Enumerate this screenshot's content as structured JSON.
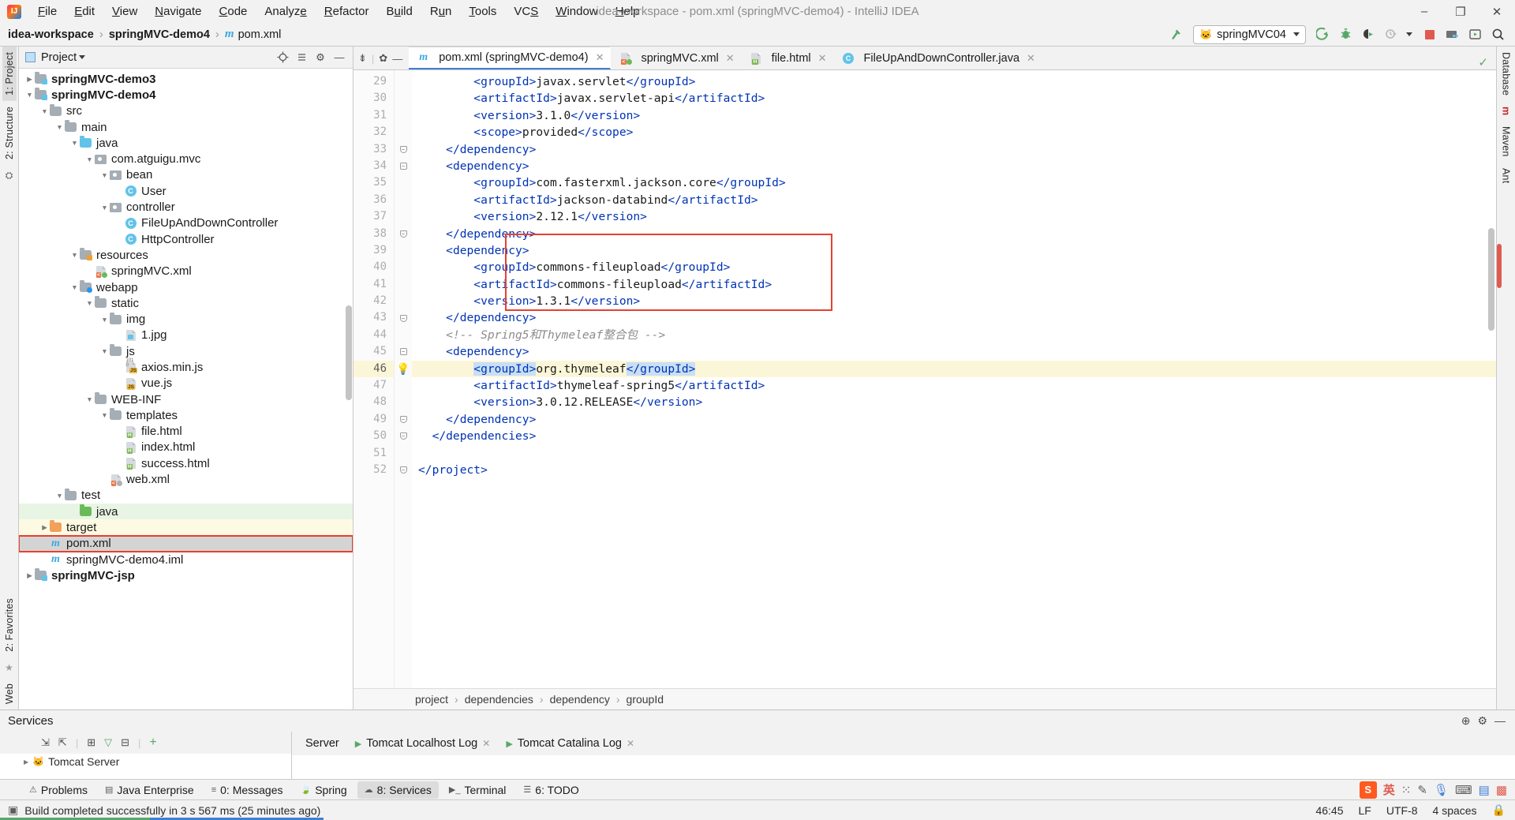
{
  "titlebar": {
    "logo": "IJ",
    "menus": [
      "File",
      "Edit",
      "View",
      "Navigate",
      "Code",
      "Analyze",
      "Refactor",
      "Build",
      "Run",
      "Tools",
      "VCS",
      "Window",
      "Help"
    ],
    "window_title": "idea-workspace - pom.xml (springMVC-demo4) - IntelliJ IDEA",
    "minimize": "–",
    "maximize": "❐",
    "close": "✕"
  },
  "navbar": {
    "breadcrumb": [
      "idea-workspace",
      "springMVC-demo4",
      "pom.xml"
    ],
    "separator": "›",
    "maven_icon": "m",
    "run_config": "springMVC04",
    "icons": {
      "hammer": "build-icon",
      "run": "run-icon",
      "debug": "debug-icon",
      "coverage": "run-with-coverage-icon",
      "profile": "profile-icon",
      "stop": "stop-icon",
      "project_structure": "project-structure-icon",
      "updates": "updates-icon",
      "search": "search-everywhere-icon"
    }
  },
  "left_strip": {
    "tabs": [
      "1: Project",
      "2: Structure"
    ],
    "bottom_tabs": [
      "2: Favorites",
      "Web"
    ]
  },
  "right_strip": {
    "tabs": [
      "Database",
      "m",
      "Maven",
      "Ant"
    ]
  },
  "project": {
    "title": "Project",
    "tree": [
      {
        "label": "springMVC-demo3",
        "indent": 1,
        "arrow": "collapsed",
        "icon": "module-folder",
        "bold": true
      },
      {
        "label": "springMVC-demo4",
        "indent": 1,
        "arrow": "expanded",
        "icon": "module-folder",
        "bold": true
      },
      {
        "label": "src",
        "indent": 2,
        "arrow": "expanded",
        "icon": "folder-gray"
      },
      {
        "label": "main",
        "indent": 3,
        "arrow": "expanded",
        "icon": "folder-gray"
      },
      {
        "label": "java",
        "indent": 4,
        "arrow": "expanded",
        "icon": "folder-blue"
      },
      {
        "label": "com.atguigu.mvc",
        "indent": 5,
        "arrow": "expanded",
        "icon": "package"
      },
      {
        "label": "bean",
        "indent": 6,
        "arrow": "expanded",
        "icon": "package"
      },
      {
        "label": "User",
        "indent": 7,
        "arrow": "none",
        "icon": "class"
      },
      {
        "label": "controller",
        "indent": 6,
        "arrow": "expanded",
        "icon": "package"
      },
      {
        "label": "FileUpAndDownController",
        "indent": 7,
        "arrow": "none",
        "icon": "class"
      },
      {
        "label": "HttpController",
        "indent": 7,
        "arrow": "none",
        "icon": "class"
      },
      {
        "label": "resources",
        "indent": 4,
        "arrow": "expanded",
        "icon": "folder-resources"
      },
      {
        "label": "springMVC.xml",
        "indent": 5,
        "arrow": "none",
        "icon": "spring-xml"
      },
      {
        "label": "webapp",
        "indent": 4,
        "arrow": "expanded",
        "icon": "webapp"
      },
      {
        "label": "static",
        "indent": 5,
        "arrow": "expanded",
        "icon": "folder-gray"
      },
      {
        "label": "img",
        "indent": 6,
        "arrow": "expanded",
        "icon": "folder-gray"
      },
      {
        "label": "1.jpg",
        "indent": 7,
        "arrow": "none",
        "icon": "image-file"
      },
      {
        "label": "js",
        "indent": 6,
        "arrow": "expanded",
        "icon": "folder-gray"
      },
      {
        "label": "axios.min.js",
        "indent": 7,
        "arrow": "none",
        "icon": "js-min-file"
      },
      {
        "label": "vue.js",
        "indent": 7,
        "arrow": "none",
        "icon": "js-file"
      },
      {
        "label": "WEB-INF",
        "indent": 5,
        "arrow": "expanded",
        "icon": "folder-gray"
      },
      {
        "label": "templates",
        "indent": 6,
        "arrow": "expanded",
        "icon": "folder-gray"
      },
      {
        "label": "file.html",
        "indent": 7,
        "arrow": "none",
        "icon": "html-file"
      },
      {
        "label": "index.html",
        "indent": 7,
        "arrow": "none",
        "icon": "html-file"
      },
      {
        "label": "success.html",
        "indent": 7,
        "arrow": "none",
        "icon": "html-file"
      },
      {
        "label": "web.xml",
        "indent": 6,
        "arrow": "none",
        "icon": "web-xml"
      },
      {
        "label": "test",
        "indent": 3,
        "arrow": "expanded",
        "icon": "folder-gray"
      },
      {
        "label": "java",
        "indent": 4,
        "arrow": "none",
        "icon": "folder-green",
        "highlight": "green"
      },
      {
        "label": "target",
        "indent": 2,
        "arrow": "collapsed",
        "icon": "folder-orange",
        "highlight": "yellow"
      },
      {
        "label": "pom.xml",
        "indent": 2,
        "arrow": "none",
        "icon": "maven-file",
        "highlight": "selected",
        "boxed": true
      },
      {
        "label": "springMVC-demo4.iml",
        "indent": 2,
        "arrow": "none",
        "icon": "iml-file"
      },
      {
        "label": "springMVC-jsp",
        "indent": 1,
        "arrow": "collapsed",
        "icon": "module-folder",
        "bold": true
      }
    ]
  },
  "editor": {
    "tabs": [
      {
        "label": "pom.xml (springMVC-demo4)",
        "icon": "maven-file",
        "active": true,
        "close": "✕"
      },
      {
        "label": "springMVC.xml",
        "icon": "spring-xml",
        "active": false,
        "close": "✕"
      },
      {
        "label": "file.html",
        "icon": "html-file",
        "active": false,
        "close": "✕"
      },
      {
        "label": "FileUpAndDownController.java",
        "icon": "class",
        "active": false,
        "close": "✕"
      }
    ],
    "inspection_ok": "✓",
    "lines": [
      {
        "n": 29,
        "indent": 8,
        "parts": [
          {
            "t": "tg",
            "v": "<groupId>"
          },
          {
            "t": "x",
            "v": "javax.servlet"
          },
          {
            "t": "tg",
            "v": "</groupId>"
          }
        ]
      },
      {
        "n": 30,
        "indent": 8,
        "parts": [
          {
            "t": "tg",
            "v": "<artifactId>"
          },
          {
            "t": "x",
            "v": "javax.servlet-api"
          },
          {
            "t": "tg",
            "v": "</artifactId>"
          }
        ]
      },
      {
        "n": 31,
        "indent": 8,
        "parts": [
          {
            "t": "tg",
            "v": "<version>"
          },
          {
            "t": "x",
            "v": "3.1.0"
          },
          {
            "t": "tg",
            "v": "</version>"
          }
        ]
      },
      {
        "n": 32,
        "indent": 8,
        "parts": [
          {
            "t": "tg",
            "v": "<scope>"
          },
          {
            "t": "x",
            "v": "provided"
          },
          {
            "t": "tg",
            "v": "</scope>"
          }
        ]
      },
      {
        "n": 33,
        "indent": 4,
        "fold": "end",
        "parts": [
          {
            "t": "tg",
            "v": "</dependency>"
          }
        ]
      },
      {
        "n": 34,
        "indent": 4,
        "fold": "start",
        "parts": [
          {
            "t": "tg",
            "v": "<dependency>"
          }
        ]
      },
      {
        "n": 35,
        "indent": 8,
        "parts": [
          {
            "t": "tg",
            "v": "<groupId>"
          },
          {
            "t": "x",
            "v": "com.fasterxml.jackson.core"
          },
          {
            "t": "tg",
            "v": "</groupId>"
          }
        ]
      },
      {
        "n": 36,
        "indent": 8,
        "parts": [
          {
            "t": "tg",
            "v": "<artifactId>"
          },
          {
            "t": "x",
            "v": "jackson-databind"
          },
          {
            "t": "tg",
            "v": "</artifactId>"
          }
        ]
      },
      {
        "n": 37,
        "indent": 8,
        "parts": [
          {
            "t": "tg",
            "v": "<version>"
          },
          {
            "t": "x",
            "v": "2.12.1"
          },
          {
            "t": "tg",
            "v": "</version>"
          }
        ]
      },
      {
        "n": 38,
        "indent": 4,
        "fold": "end",
        "parts": [
          {
            "t": "tg",
            "v": "</dependency>"
          }
        ]
      },
      {
        "n": 39,
        "indent": 4,
        "parts": [
          {
            "t": "tg",
            "v": "<dependency>"
          }
        ]
      },
      {
        "n": 40,
        "indent": 8,
        "parts": [
          {
            "t": "tg",
            "v": "<groupId>"
          },
          {
            "t": "x",
            "v": "commons-fileupload"
          },
          {
            "t": "tg",
            "v": "</groupId>"
          }
        ]
      },
      {
        "n": 41,
        "indent": 8,
        "parts": [
          {
            "t": "tg",
            "v": "<artifactId>"
          },
          {
            "t": "x",
            "v": "commons-fileupload"
          },
          {
            "t": "tg",
            "v": "</artifactId>"
          }
        ]
      },
      {
        "n": 42,
        "indent": 8,
        "parts": [
          {
            "t": "tg",
            "v": "<version>"
          },
          {
            "t": "x",
            "v": "1.3.1"
          },
          {
            "t": "tg",
            "v": "</version>"
          }
        ]
      },
      {
        "n": 43,
        "indent": 4,
        "fold": "end",
        "parts": [
          {
            "t": "tg",
            "v": "</dependency>"
          }
        ]
      },
      {
        "n": 44,
        "indent": 4,
        "parts": [
          {
            "t": "cm",
            "v": "<!-- Spring5和Thymeleaf整合包 -->"
          }
        ]
      },
      {
        "n": 45,
        "indent": 4,
        "fold": "start",
        "parts": [
          {
            "t": "tg",
            "v": "<dependency>"
          }
        ]
      },
      {
        "n": 46,
        "indent": 8,
        "current": true,
        "bulb": true,
        "parts": [
          {
            "t": "sel",
            "v": "<groupId>"
          },
          {
            "t": "x",
            "v": "org.thymeleaf"
          },
          {
            "t": "sel",
            "v": "</groupId>"
          }
        ]
      },
      {
        "n": 47,
        "indent": 8,
        "parts": [
          {
            "t": "tg",
            "v": "<artifactId>"
          },
          {
            "t": "x",
            "v": "thymeleaf-spring5"
          },
          {
            "t": "tg",
            "v": "</artifactId>"
          }
        ]
      },
      {
        "n": 48,
        "indent": 8,
        "parts": [
          {
            "t": "tg",
            "v": "<version>"
          },
          {
            "t": "x",
            "v": "3.0.12.RELEASE"
          },
          {
            "t": "tg",
            "v": "</version>"
          }
        ]
      },
      {
        "n": 49,
        "indent": 4,
        "fold": "end",
        "parts": [
          {
            "t": "tg",
            "v": "</dependency>"
          }
        ]
      },
      {
        "n": 50,
        "indent": 2,
        "fold": "end",
        "parts": [
          {
            "t": "tg",
            "v": "</dependencies>"
          }
        ]
      },
      {
        "n": 51,
        "indent": 0,
        "parts": []
      },
      {
        "n": 52,
        "indent": 0,
        "fold": "end",
        "parts": [
          {
            "t": "tg",
            "v": "</project>"
          }
        ]
      }
    ],
    "breadcrumb": [
      "project",
      "dependencies",
      "dependency",
      "groupId"
    ],
    "breadcrumb_sep": "›"
  },
  "services": {
    "title": "Services",
    "left_header": "Server",
    "tree_item": "Tomcat Server",
    "tabs": [
      {
        "label": "Tomcat Localhost Log",
        "close": "✕"
      },
      {
        "label": "Tomcat Catalina Log",
        "close": "✕"
      }
    ]
  },
  "toolwindows": {
    "items": [
      {
        "label": "Problems",
        "icon": "problems-icon",
        "active": false
      },
      {
        "label": "Java Enterprise",
        "icon": "java-ee-icon",
        "active": false
      },
      {
        "label": "0: Messages",
        "icon": "messages-icon",
        "active": false
      },
      {
        "label": "Spring",
        "icon": "spring-icon",
        "active": false
      },
      {
        "label": "8: Services",
        "icon": "services-icon",
        "active": true
      },
      {
        "label": "Terminal",
        "icon": "terminal-icon",
        "active": false
      },
      {
        "label": "6: TODO",
        "icon": "todo-icon",
        "active": false
      }
    ],
    "tray": [
      "英",
      "…",
      "✎",
      "🎙",
      "⌨",
      "⬚",
      "⚙"
    ]
  },
  "statusbar": {
    "message": "Build completed successfully in 3 s 567 ms (25 minutes ago)",
    "caret": "46:45",
    "line_sep": "LF",
    "encoding": "UTF-8",
    "indent": "4 spaces",
    "lock": "🔒"
  }
}
